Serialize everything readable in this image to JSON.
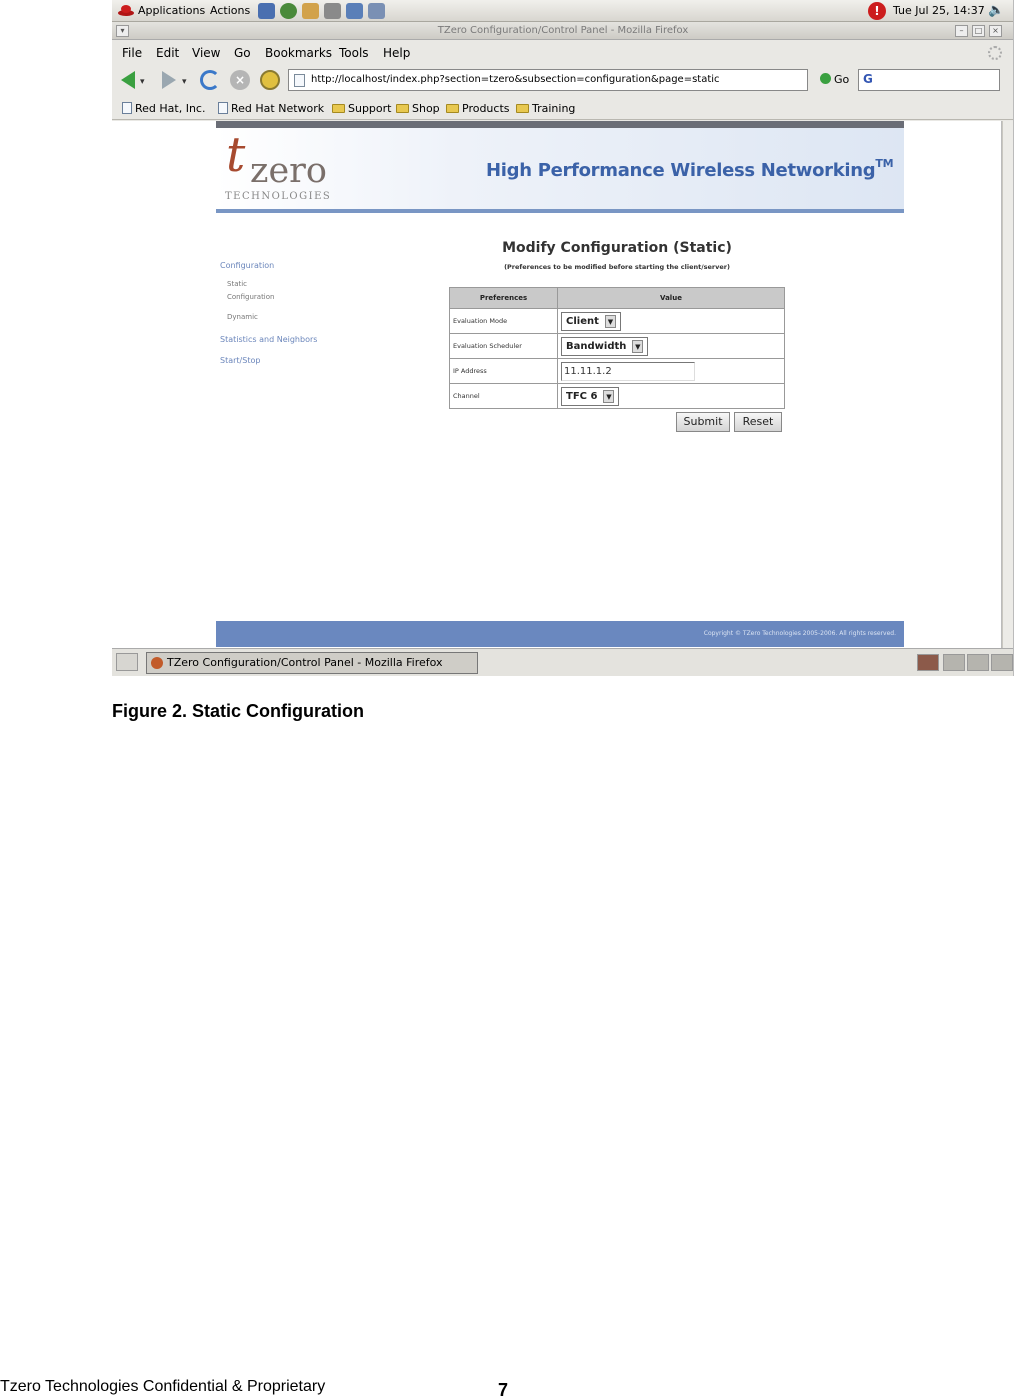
{
  "gnome_panel": {
    "applications": "Applications",
    "actions": "Actions",
    "clock": "Tue Jul 25, 14:37"
  },
  "window": {
    "title": "TZero Configuration/Control Panel - Mozilla Firefox"
  },
  "menu": {
    "file": "File",
    "edit": "Edit",
    "view": "View",
    "go": "Go",
    "bookmarks": "Bookmarks",
    "tools": "Tools",
    "help": "Help"
  },
  "navbar": {
    "url": "http://localhost/index.php?section=tzero&subsection=configuration&page=static",
    "go_label": "Go",
    "search_value": "G"
  },
  "bookmarks_toolbar": {
    "items": [
      "Red Hat, Inc.",
      "Red Hat Network",
      "Support",
      "Shop",
      "Products",
      "Training"
    ]
  },
  "site": {
    "logo_t": "t",
    "logo_name": "zero",
    "logo_sub": "TECHNOLOGIES",
    "tagline": "High Performance Wireless Networking",
    "tagline_tm": "TM",
    "nav": {
      "configuration": "Configuration",
      "static": "Static",
      "static_sub": "Configuration",
      "dynamic": "Dynamic",
      "statistics": "Statistics and Neighbors",
      "start_stop": "Start/Stop"
    },
    "page_title": "Modify Configuration (Static)",
    "page_subtitle": "(Preferences to be modified before starting the client/server)",
    "table": {
      "col_preferences": "Preferences",
      "col_value": "Value",
      "rows": [
        {
          "label": "Evaluation Mode",
          "value": "Client"
        },
        {
          "label": "Evaluation Scheduler",
          "value": "Bandwidth"
        },
        {
          "label": "IP Address",
          "value": "11.11.1.2"
        },
        {
          "label": "Channel",
          "value": "TFC 6"
        }
      ]
    },
    "submit_label": "Submit",
    "reset_label": "Reset",
    "copyright": "Copyright © TZero Technologies 2005-2006. All rights reserved."
  },
  "taskbar": {
    "task_label": "TZero Configuration/Control Panel - Mozilla Firefox"
  },
  "document": {
    "caption": "Figure 2. Static Configuration",
    "footer": "Tzero Technologies Confidential & Proprietary",
    "page_number": "7"
  },
  "colors": {
    "brand_blue": "#3b62a8",
    "logo_red": "#a74a2f",
    "footer_bar": "#6a88bf"
  }
}
